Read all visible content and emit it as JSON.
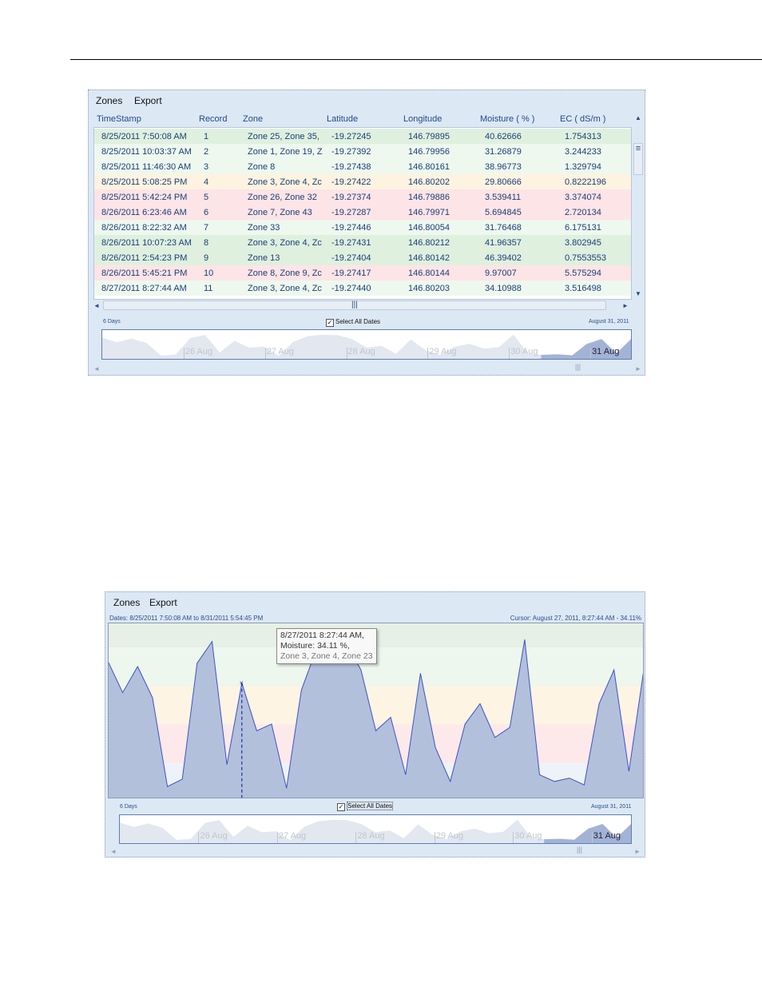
{
  "grid_view": {
    "menu": {
      "zones": "Zones",
      "export": "Export"
    },
    "columns": [
      "TimeStamp",
      "Record",
      "Zone",
      "Latitude",
      "Longitude",
      "Moisture ( % )",
      "EC ( dS/m )"
    ],
    "rows": [
      {
        "ts": "8/25/2011 7:50:08 AM",
        "rec": "1",
        "zone": "Zone  25, Zone  35,",
        "lat": "-19.27245",
        "lon": "146.79895",
        "moist": "40.62666",
        "ec": "1.754313",
        "status": "green"
      },
      {
        "ts": "8/25/2011 10:03:37 AM",
        "rec": "2",
        "zone": "Zone  1, Zone  19, Z",
        "lat": "-19.27392",
        "lon": "146.79956",
        "moist": "31.26879",
        "ec": "3.244233",
        "status": "lightgreen"
      },
      {
        "ts": "8/25/2011 11:46:30 AM",
        "rec": "3",
        "zone": "Zone  8",
        "lat": "-19.27438",
        "lon": "146.80161",
        "moist": "38.96773",
        "ec": "1.329794",
        "status": "lightgreen"
      },
      {
        "ts": "8/25/2011 5:08:25 PM",
        "rec": "4",
        "zone": "Zone  3, Zone  4, Zc",
        "lat": "-19.27422",
        "lon": "146.80202",
        "moist": "29.80666",
        "ec": "0.8222196",
        "status": "yellow"
      },
      {
        "ts": "8/25/2011 5:42:24 PM",
        "rec": "5",
        "zone": "Zone  26, Zone  32",
        "lat": "-19.27374",
        "lon": "146.79886",
        "moist": "3.539411",
        "ec": "3.374074",
        "status": "red"
      },
      {
        "ts": "8/26/2011 6:23:46 AM",
        "rec": "6",
        "zone": "Zone  7, Zone  43",
        "lat": "-19.27287",
        "lon": "146.79971",
        "moist": "5.694845",
        "ec": "2.720134",
        "status": "red"
      },
      {
        "ts": "8/26/2011 8:22:32 AM",
        "rec": "7",
        "zone": "Zone  33",
        "lat": "-19.27446",
        "lon": "146.80054",
        "moist": "31.76468",
        "ec": "6.175131",
        "status": "lightgreen"
      },
      {
        "ts": "8/26/2011 10:07:23 AM",
        "rec": "8",
        "zone": "Zone  3, Zone  4, Zc",
        "lat": "-19.27431",
        "lon": "146.80212",
        "moist": "41.96357",
        "ec": "3.802945",
        "status": "green"
      },
      {
        "ts": "8/26/2011 2:54:23 PM",
        "rec": "9",
        "zone": "Zone  13",
        "lat": "-19.27404",
        "lon": "146.80142",
        "moist": "46.39402",
        "ec": "0.7553553",
        "status": "green"
      },
      {
        "ts": "8/26/2011 5:45:21 PM",
        "rec": "10",
        "zone": "Zone  8, Zone  9, Zc",
        "lat": "-19.27417",
        "lon": "146.80144",
        "moist": "9.97007",
        "ec": "5.575294",
        "status": "red"
      },
      {
        "ts": "8/27/2011 8:27:44 AM",
        "rec": "11",
        "zone": "Zone  3, Zone  4, Zc",
        "lat": "-19.27440",
        "lon": "146.80203",
        "moist": "34.10988",
        "ec": "3.516498",
        "status": "lightgreen"
      }
    ],
    "navigator": {
      "range_label": "6 Days",
      "select_all": "Select All Dates",
      "end_date": "August 31, 2011",
      "ticks": [
        "26 Aug",
        "27 Aug",
        "28 Aug",
        "29 Aug",
        "30 Aug",
        "31 Aug"
      ],
      "scroll_grip": "|||"
    },
    "scroll_grip": "|||"
  },
  "chart_view": {
    "menu": {
      "zones": "Zones",
      "export": "Export"
    },
    "dates_label": "Dates: 8/25/2011 7:50:08 AM  to 8/31/2011 5:54:45 PM",
    "cursor_label": "Cursor: August 27, 2011, 8:27:44 AM - 34.11%",
    "tooltip": {
      "line1": "8/27/2011 8:27:44 AM,",
      "line2": "Moisture: 34.11 %,",
      "line3": "Zone  3, Zone  4, Zone  23"
    },
    "navigator": {
      "range_label": "6 Days",
      "select_all": "Select All Dates",
      "end_date": "August 31, 2011",
      "ticks": [
        "26 Aug",
        "27 Aug",
        "28 Aug",
        "29 Aug",
        "30 Aug",
        "31 Aug"
      ],
      "scroll_grip": "|||"
    }
  },
  "chart_data": {
    "type": "area",
    "series": [
      {
        "values": [
          40.6,
          31.3,
          39.0,
          29.8,
          3.5,
          5.7,
          40.0,
          46.4,
          9.97,
          34.1,
          20.0,
          22.0,
          3.0,
          32.0,
          44.0,
          47.0,
          46.0,
          38.0,
          20.0,
          24.0,
          7.0,
          37.0,
          15.0,
          5.0,
          22.0,
          28.0,
          18.0,
          21.0,
          47.0,
          7.0,
          5.0,
          6.0,
          4.0,
          28.0,
          38.0,
          8.0,
          38.0
        ]
      }
    ],
    "cursor_value": 34.11,
    "colors": {
      "area": "#b2c0dc",
      "line": "#3f52c4",
      "band_green": "#e6f0e6",
      "band_lightgreen": "#eef7ee",
      "band_yellow": "#fdf4e3",
      "band_red": "#fde9ea"
    }
  }
}
